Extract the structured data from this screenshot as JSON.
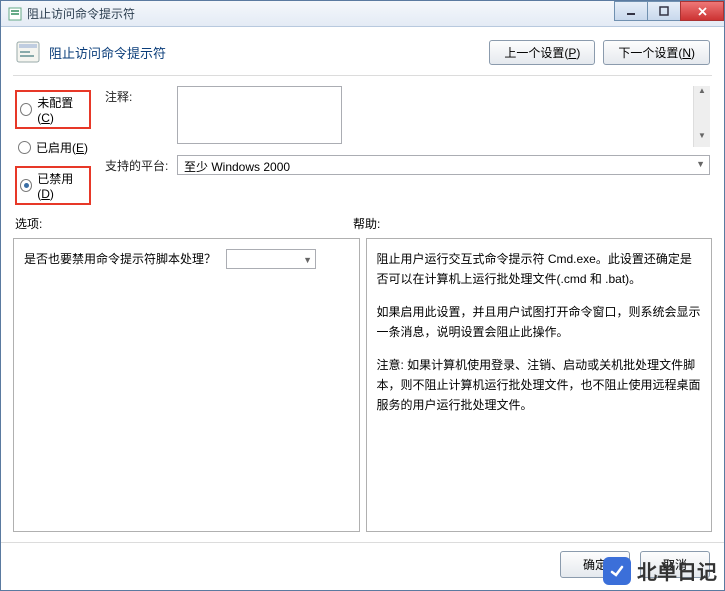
{
  "title": "阻止访问命令提示符",
  "header": {
    "policy_name": "阻止访问命令提示符",
    "prev_label": "上一个设置(P)",
    "next_label": "下一个设置(N)"
  },
  "radios": {
    "not_configured": "未配置(C)",
    "enabled": "已启用(E)",
    "disabled": "已禁用(D)",
    "selected": "disabled"
  },
  "fields": {
    "comment_label": "注释:",
    "comment_value": "",
    "supported_label": "支持的平台:",
    "supported_value": "至少 Windows 2000"
  },
  "sections": {
    "options_label": "选项:",
    "help_label": "帮助:"
  },
  "options": {
    "question": "是否也要禁用命令提示符脚本处理？",
    "select_value": ""
  },
  "help": {
    "p1": "阻止用户运行交互式命令提示符 Cmd.exe。此设置还确定是否可以在计算机上运行批处理文件(.cmd 和 .bat)。",
    "p2": "如果启用此设置，并且用户试图打开命令窗口，则系统会显示一条消息，说明设置会阻止此操作。",
    "p3": "注意: 如果计算机使用登录、注销、启动或关机批处理文件脚本，则不阻止计算机运行批处理文件，也不阻止使用远程桌面服务的用户运行批处理文件。"
  },
  "footer": {
    "ok": "确定",
    "cancel": "取消"
  },
  "watermark": "北单日记"
}
